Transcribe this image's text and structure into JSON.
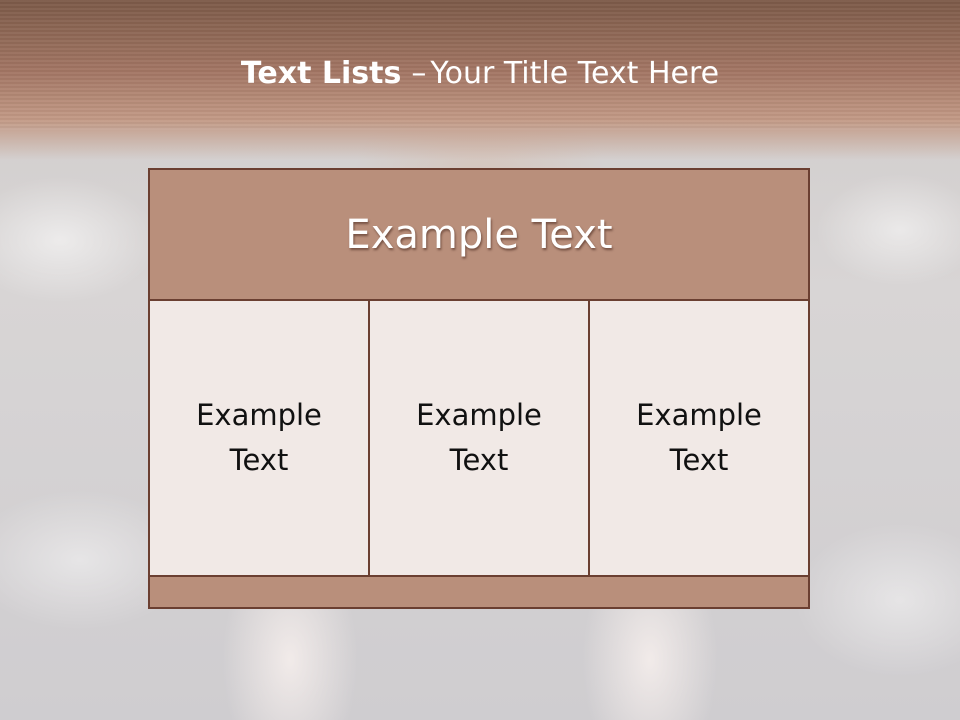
{
  "slide": {
    "title_bold": "Text Lists",
    "title_separator": "–",
    "title_rest": "Your Title Text Here"
  },
  "diagram": {
    "header": "Example Text",
    "columns": [
      {
        "text": "Example Text"
      },
      {
        "text": "Example Text"
      },
      {
        "text": "Example Text"
      }
    ]
  },
  "colors": {
    "title_band": "#a37664",
    "header_fill": "#b98f7b",
    "column_fill": "#f1e9e6",
    "border": "#6b3f31",
    "title_text": "#ffffff",
    "body_text": "#111111"
  }
}
